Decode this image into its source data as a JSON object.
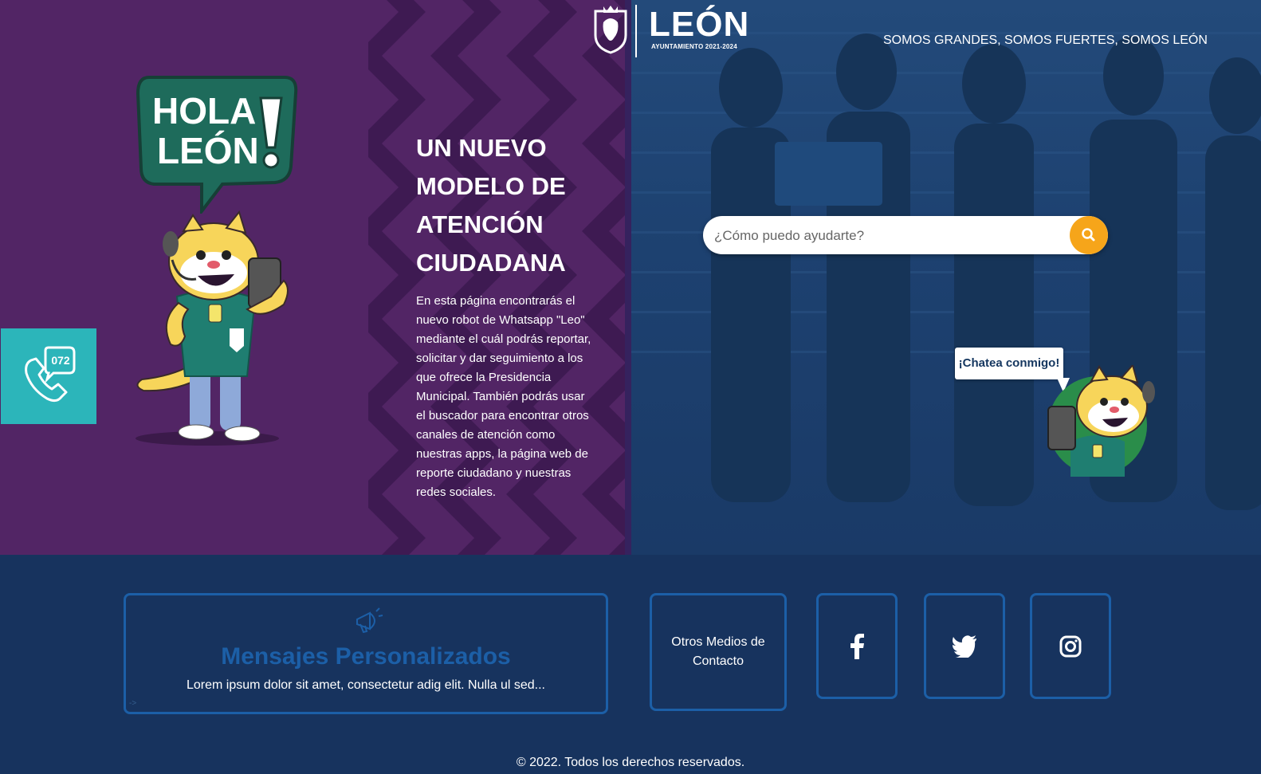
{
  "header": {
    "logo_word": "LEÓN",
    "logo_sub": "AYUNTAMIENTO 2021-2024",
    "slogan": "SOMOS GRANDES, SOMOS FUERTES, SOMOS LEÓN"
  },
  "hero": {
    "badge_text": "HOLA LEÓN!",
    "heading": "UN NUEVO MODELO DE ATENCIÓN CIUDADANA",
    "paragraph": "En esta página encontrarás el nuevo robot de Whatsapp \"Leo\" mediante el cuál podrás reportar, solicitar y dar seguimiento a los que ofrece la Presidencia Municipal. También podrás usar el buscador para encontrar otros canales de atención como nuestras apps, la página web de reporte ciudadano y nuestras redes sociales."
  },
  "phone_widget": {
    "number": "072",
    "icon": "phone-icon"
  },
  "search": {
    "placeholder": "¿Cómo puedo ayudarte?",
    "icon": "search-icon"
  },
  "chat": {
    "label": "¡Chatea conmigo!"
  },
  "cards": {
    "messages": {
      "title": "Mensajes Personalizados",
      "description": "Lorem ipsum dolor sit amet, consectetur adig elit. Nulla ul sed...",
      "icon": "megaphone-icon",
      "arrow": "->"
    },
    "other_contact": "Otros Medios de Contacto",
    "social": [
      {
        "name": "facebook",
        "icon": "facebook-icon"
      },
      {
        "name": "twitter",
        "icon": "twitter-icon"
      },
      {
        "name": "instagram",
        "icon": "instagram-icon"
      }
    ]
  },
  "footer": {
    "text": "© 2022. Todos los derechos reservados."
  },
  "colors": {
    "purple": "#522565",
    "navy": "#17335e",
    "accent_orange": "#f6a51a",
    "teal": "#2cb5ba",
    "card_border": "#1c5fa7",
    "hola_green": "#1e6b5b"
  }
}
